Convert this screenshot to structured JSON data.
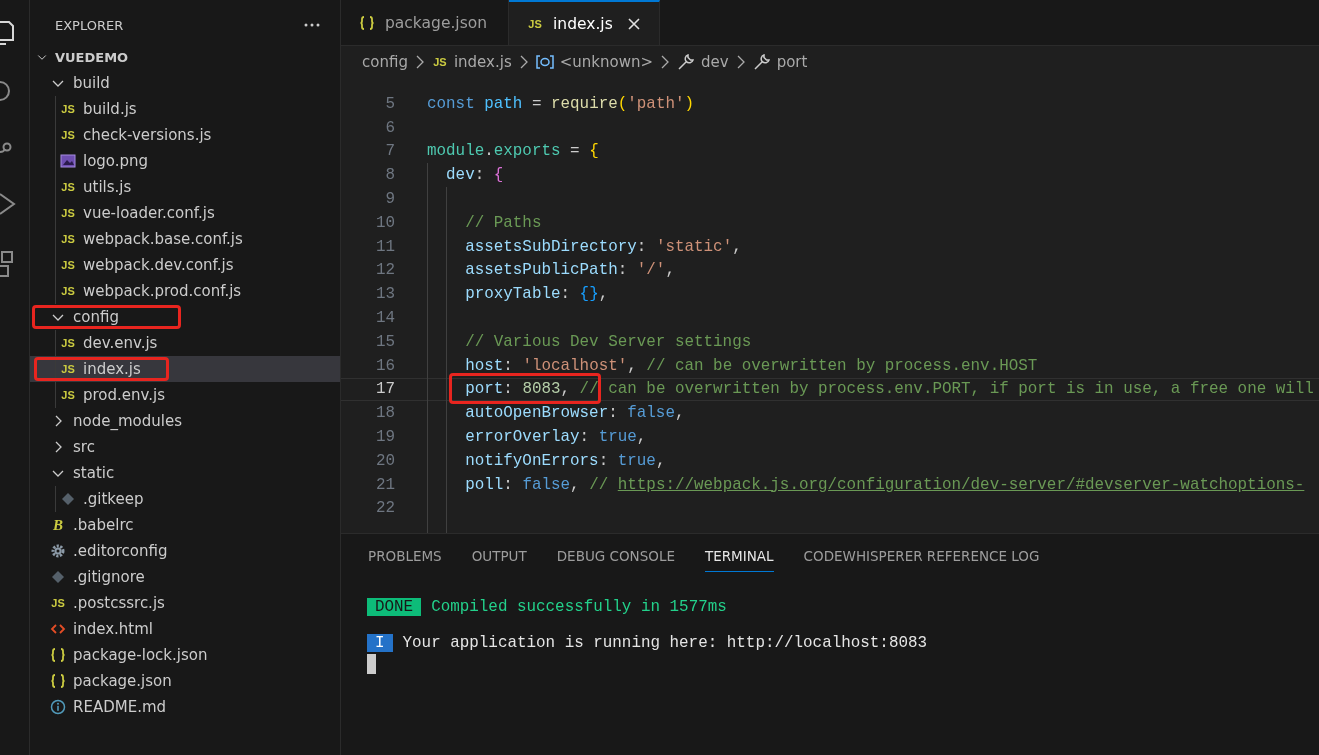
{
  "explorer": {
    "title": "EXPLORER",
    "tree": [
      {
        "name": "VUEDEMO",
        "kind": "root",
        "expanded": true,
        "selected": false,
        "annotated": false,
        "children": [
          {
            "name": "build",
            "kind": "folder",
            "expanded": true,
            "selected": false,
            "annotated": false,
            "children": [
              {
                "name": "build.js",
                "kind": "js",
                "icon_label": "JS",
                "selected": false,
                "annotated": false
              },
              {
                "name": "check-versions.js",
                "kind": "js",
                "icon_label": "JS",
                "selected": false,
                "annotated": false
              },
              {
                "name": "logo.png",
                "kind": "image",
                "selected": false,
                "annotated": false
              },
              {
                "name": "utils.js",
                "kind": "js",
                "icon_label": "JS",
                "selected": false,
                "annotated": false
              },
              {
                "name": "vue-loader.conf.js",
                "kind": "js",
                "icon_label": "JS",
                "selected": false,
                "annotated": false
              },
              {
                "name": "webpack.base.conf.js",
                "kind": "js",
                "icon_label": "JS",
                "selected": false,
                "annotated": false
              },
              {
                "name": "webpack.dev.conf.js",
                "kind": "js",
                "icon_label": "JS",
                "selected": false,
                "annotated": false
              },
              {
                "name": "webpack.prod.conf.js",
                "kind": "js",
                "icon_label": "JS",
                "selected": false,
                "annotated": false
              }
            ]
          },
          {
            "name": "config",
            "kind": "folder",
            "expanded": true,
            "selected": false,
            "annotated": true,
            "children": [
              {
                "name": "dev.env.js",
                "kind": "js",
                "icon_label": "JS",
                "selected": false,
                "annotated": false
              },
              {
                "name": "index.js",
                "kind": "js",
                "icon_label": "JS",
                "selected": true,
                "annotated": true
              },
              {
                "name": "prod.env.js",
                "kind": "js",
                "icon_label": "JS",
                "selected": false,
                "annotated": false
              }
            ]
          },
          {
            "name": "node_modules",
            "kind": "folder",
            "expanded": false,
            "selected": false,
            "annotated": false
          },
          {
            "name": "src",
            "kind": "folder",
            "expanded": false,
            "selected": false,
            "annotated": false
          },
          {
            "name": "static",
            "kind": "folder",
            "expanded": true,
            "selected": false,
            "annotated": false,
            "children": [
              {
                "name": ".gitkeep",
                "kind": "git",
                "selected": false,
                "annotated": false
              }
            ]
          },
          {
            "name": ".babelrc",
            "kind": "babel",
            "icon_label": "B",
            "selected": false,
            "annotated": false
          },
          {
            "name": ".editorconfig",
            "kind": "gear",
            "selected": false,
            "annotated": false
          },
          {
            "name": ".gitignore",
            "kind": "git",
            "selected": false,
            "annotated": false
          },
          {
            "name": ".postcssrc.js",
            "kind": "js",
            "icon_label": "JS",
            "selected": false,
            "annotated": false
          },
          {
            "name": "index.html",
            "kind": "html",
            "selected": false,
            "annotated": false
          },
          {
            "name": "package-lock.json",
            "kind": "json",
            "selected": false,
            "annotated": false
          },
          {
            "name": "package.json",
            "kind": "json",
            "selected": false,
            "annotated": false
          },
          {
            "name": "README.md",
            "kind": "info",
            "selected": false,
            "annotated": false
          }
        ]
      }
    ]
  },
  "tabs": [
    {
      "label": "package.json",
      "kind": "json",
      "selected": false
    },
    {
      "label": "index.js",
      "kind": "js",
      "icon_label": "JS",
      "selected": true
    }
  ],
  "breadcrumb": [
    {
      "text": "config",
      "kind": "folder"
    },
    {
      "text": "index.js",
      "kind": "js",
      "icon_label": "JS"
    },
    {
      "text": "<unknown>",
      "kind": "symbol"
    },
    {
      "text": "dev",
      "kind": "property"
    },
    {
      "text": "port",
      "kind": "property"
    }
  ],
  "code": [
    {
      "number": "5",
      "current": false,
      "tokens": [
        {
          "text": "const",
          "kind": "kw"
        },
        {
          "text": " path",
          "kind": "var"
        },
        {
          "text": " = ",
          "kind": "punct"
        },
        {
          "text": "require",
          "kind": "func"
        },
        {
          "text": "(",
          "kind": "brace1"
        },
        {
          "text": "'path'",
          "kind": "str"
        },
        {
          "text": ")",
          "kind": "brace1"
        }
      ]
    },
    {
      "number": "6",
      "current": false
    },
    {
      "number": "7",
      "current": false,
      "tokens": [
        {
          "text": "module",
          "kind": "type"
        },
        {
          "text": ".",
          "kind": "punct"
        },
        {
          "text": "exports",
          "kind": "type"
        },
        {
          "text": " = ",
          "kind": "punct"
        },
        {
          "text": "{",
          "kind": "brace1"
        }
      ]
    },
    {
      "number": "8",
      "current": false,
      "tokens": [
        {
          "text": "  dev",
          "kind": "prop"
        },
        {
          "text": ": ",
          "kind": "punct"
        },
        {
          "text": "{",
          "kind": "brace2"
        }
      ]
    },
    {
      "number": "9",
      "current": false
    },
    {
      "number": "10",
      "current": false,
      "tokens": [
        {
          "text": "    // Paths",
          "kind": "comment"
        }
      ]
    },
    {
      "number": "11",
      "current": false,
      "tokens": [
        {
          "text": "    assetsSubDirectory",
          "kind": "prop"
        },
        {
          "text": ": ",
          "kind": "punct"
        },
        {
          "text": "'static'",
          "kind": "str"
        },
        {
          "text": ",",
          "kind": "punct"
        }
      ]
    },
    {
      "number": "12",
      "current": false,
      "tokens": [
        {
          "text": "    assetsPublicPath",
          "kind": "prop"
        },
        {
          "text": ": ",
          "kind": "punct"
        },
        {
          "text": "'/'",
          "kind": "str"
        },
        {
          "text": ",",
          "kind": "punct"
        }
      ]
    },
    {
      "number": "13",
      "current": false,
      "tokens": [
        {
          "text": "    proxyTable",
          "kind": "prop"
        },
        {
          "text": ": ",
          "kind": "punct"
        },
        {
          "text": "{}",
          "kind": "brace3"
        },
        {
          "text": ",",
          "kind": "punct"
        }
      ]
    },
    {
      "number": "14",
      "current": false
    },
    {
      "number": "15",
      "current": false,
      "tokens": [
        {
          "text": "    // Various Dev Server settings",
          "kind": "comment"
        }
      ]
    },
    {
      "number": "16",
      "current": false,
      "tokens": [
        {
          "text": "    host",
          "kind": "prop"
        },
        {
          "text": ": ",
          "kind": "punct"
        },
        {
          "text": "'localhost'",
          "kind": "str"
        },
        {
          "text": ", ",
          "kind": "punct"
        },
        {
          "text": "// can be overwritten by process.env.HOST",
          "kind": "comment"
        }
      ]
    },
    {
      "number": "17",
      "current": true,
      "tokens": [
        {
          "text": "    port",
          "kind": "prop",
          "annotated": true
        },
        {
          "text": ": ",
          "kind": "punct",
          "annotated": true
        },
        {
          "text": "8083",
          "kind": "num",
          "annotated": true
        },
        {
          "text": ", ",
          "kind": "punct",
          "annotated": true
        },
        {
          "text": "//",
          "kind": "comment",
          "annotated": true
        },
        {
          "text": " can be overwritten by process.env.PORT, if port is in use, a free one will",
          "kind": "comment"
        }
      ]
    },
    {
      "number": "18",
      "current": false,
      "tokens": [
        {
          "text": "    autoOpenBrowser",
          "kind": "prop"
        },
        {
          "text": ": ",
          "kind": "punct"
        },
        {
          "text": "false",
          "kind": "bool"
        },
        {
          "text": ",",
          "kind": "punct"
        }
      ]
    },
    {
      "number": "19",
      "current": false,
      "tokens": [
        {
          "text": "    errorOverlay",
          "kind": "prop"
        },
        {
          "text": ": ",
          "kind": "punct"
        },
        {
          "text": "true",
          "kind": "bool"
        },
        {
          "text": ",",
          "kind": "punct"
        }
      ]
    },
    {
      "number": "20",
      "current": false,
      "tokens": [
        {
          "text": "    notifyOnErrors",
          "kind": "prop"
        },
        {
          "text": ": ",
          "kind": "punct"
        },
        {
          "text": "true",
          "kind": "bool"
        },
        {
          "text": ",",
          "kind": "punct"
        }
      ]
    },
    {
      "number": "21",
      "current": false,
      "tokens": [
        {
          "text": "    poll",
          "kind": "prop"
        },
        {
          "text": ": ",
          "kind": "punct"
        },
        {
          "text": "false",
          "kind": "bool"
        },
        {
          "text": ", ",
          "kind": "punct"
        },
        {
          "text": "// ",
          "kind": "comment"
        },
        {
          "text": "https://webpack.js.org/configuration/dev-server/#devserver-watchoptions-",
          "kind": "link"
        }
      ]
    },
    {
      "number": "22",
      "current": false
    }
  ],
  "panel_tabs": [
    {
      "label": "PROBLEMS",
      "selected": false
    },
    {
      "label": "OUTPUT",
      "selected": false
    },
    {
      "label": "DEBUG CONSOLE",
      "selected": false
    },
    {
      "label": "TERMINAL",
      "selected": true
    },
    {
      "label": "CODEWHISPERER REFERENCE LOG",
      "selected": false
    }
  ],
  "terminal": [
    {
      "kind": "success",
      "badge": "DONE",
      "text": "Compiled successfully in 1577ms"
    },
    {
      "kind": "info",
      "badge": "I",
      "text": "Your application is running here: http://localhost:8083"
    }
  ]
}
